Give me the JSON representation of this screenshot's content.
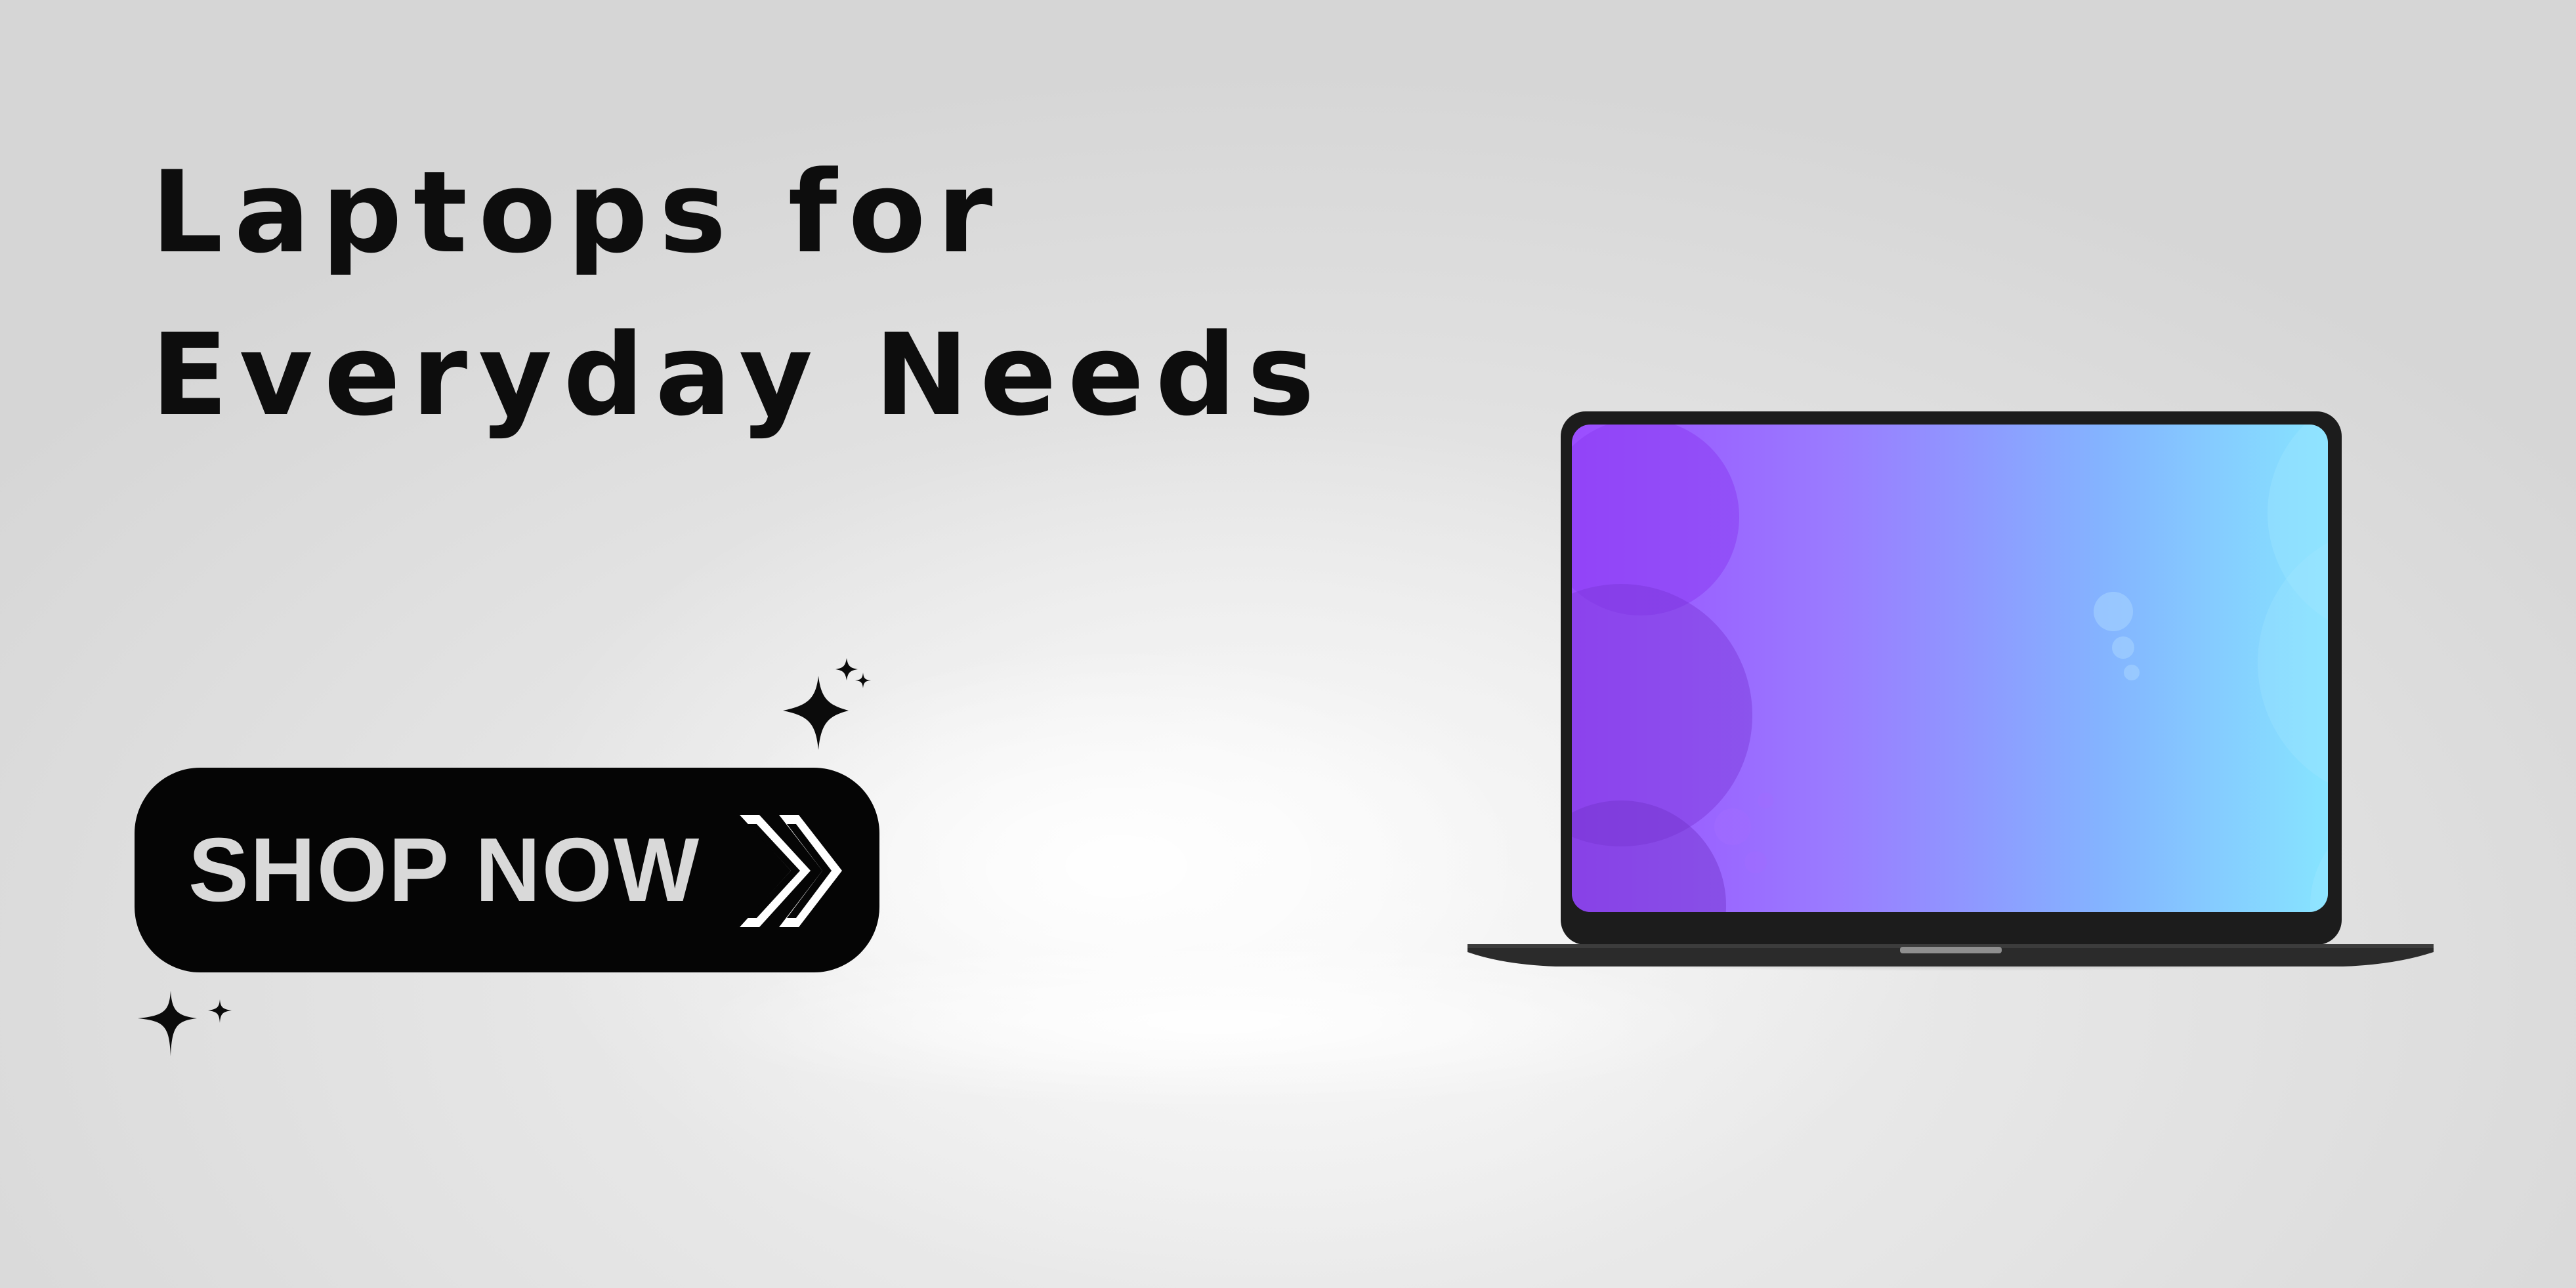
{
  "headline": {
    "line1": "Laptops for",
    "line2": "Everyday Needs"
  },
  "cta": {
    "label": "SHOP NOW",
    "icon": "double-chevron-right-icon"
  },
  "decorations": {
    "sparkles": [
      "sparkle-icon",
      "sparkle-icon"
    ]
  },
  "colors": {
    "text": "#0d0d0d",
    "button_bg": "#050505",
    "button_text": "#d9d9d9",
    "screen_gradient_start": "#9b4dff",
    "screen_gradient_end": "#86e4ff",
    "laptop_body": "#1c1c1c"
  }
}
